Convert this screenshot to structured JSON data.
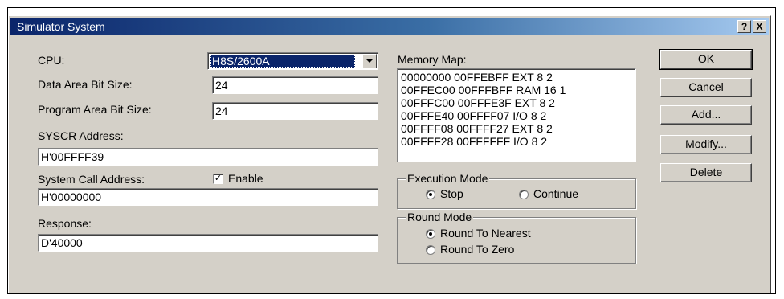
{
  "window": {
    "title": "Simulator System",
    "help_btn": "?",
    "close_btn": "X"
  },
  "cpu": {
    "label": "CPU:",
    "value": "H8S/2600A"
  },
  "data_area": {
    "label": "Data Area Bit Size:",
    "value": "24"
  },
  "program_area": {
    "label": "Program Area Bit Size:",
    "value": "24"
  },
  "syscr": {
    "label": "SYSCR Address:",
    "value": "H'00FFFF39"
  },
  "system_call": {
    "label": "System Call Address:",
    "value": "H'00000000",
    "enable_label": "Enable",
    "enable_checked": true
  },
  "response": {
    "label": "Response:",
    "value": "D'40000"
  },
  "memory_map": {
    "label": "Memory Map:",
    "rows": [
      "00000000 00FFEBFF EXT 8 2",
      "00FFEC00 00FFFBFF RAM 16 1",
      "00FFFC00 00FFFE3F EXT 8 2",
      "00FFFE40 00FFFF07 I/O 8 2",
      "00FFFF08 00FFFF27 EXT 8 2",
      "00FFFF28 00FFFFFF I/O 8 2"
    ]
  },
  "execution_mode": {
    "label": "Execution Mode",
    "stop": "Stop",
    "continue": "Continue",
    "selected": "Stop"
  },
  "round_mode": {
    "label": "Round Mode",
    "nearest": "Round To Nearest",
    "zero": "Round To Zero",
    "selected": "Round To Nearest"
  },
  "buttons": {
    "ok": "OK",
    "cancel": "Cancel",
    "add": "Add...",
    "modify": "Modify...",
    "delete": "Delete"
  }
}
